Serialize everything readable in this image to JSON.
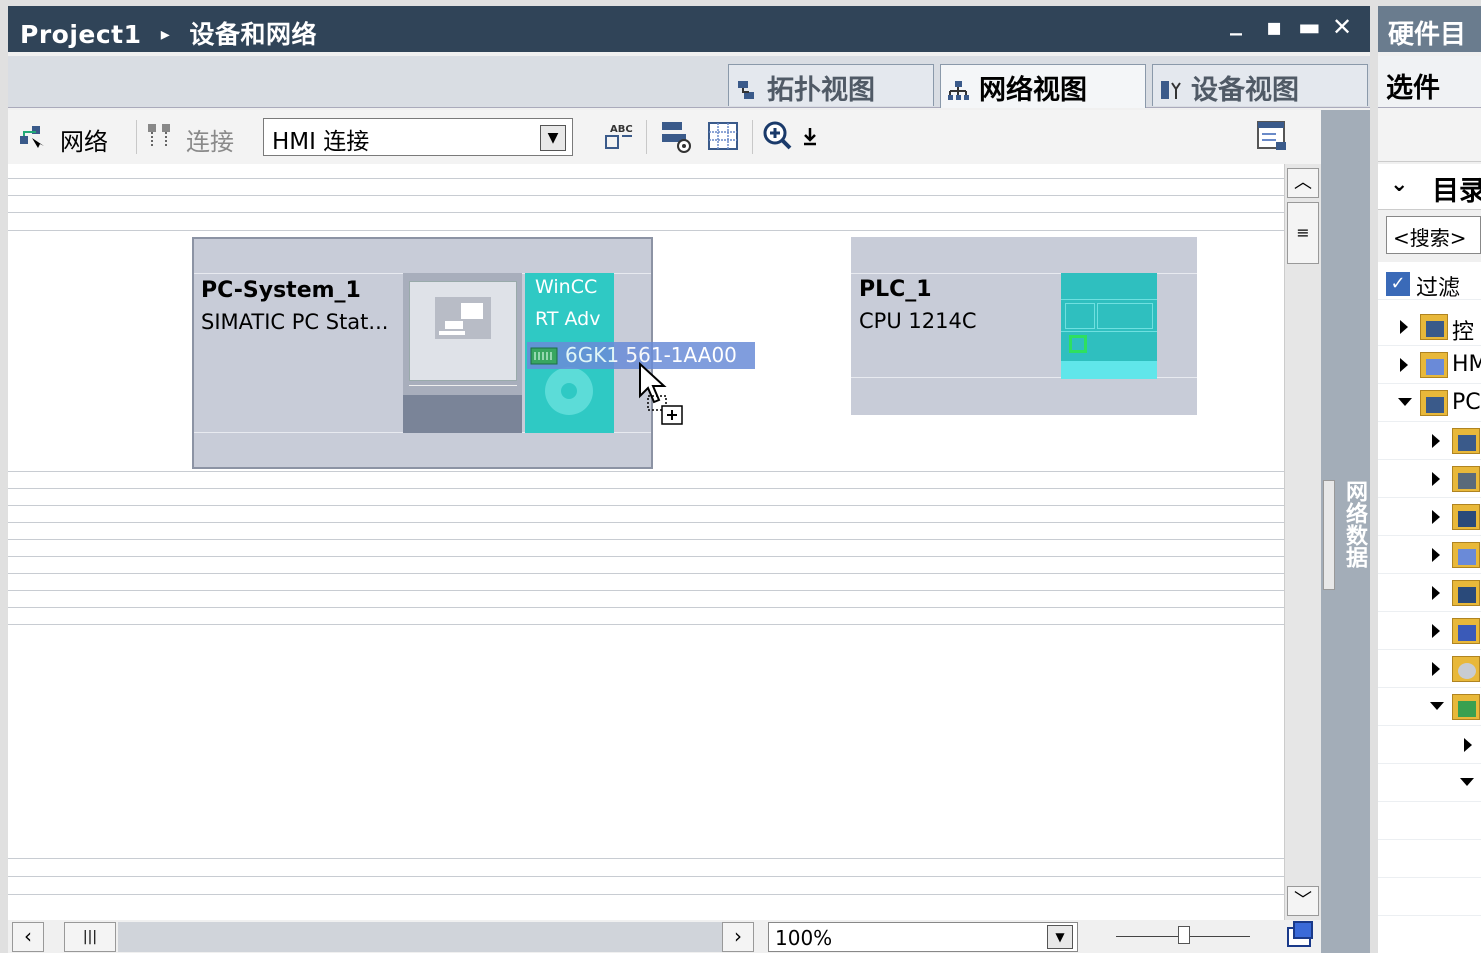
{
  "editor": {
    "breadcrumb_project": "Project1",
    "breadcrumb_sep": "▸",
    "breadcrumb_page": "设备和网络",
    "window_controls": [
      "_",
      "▪",
      "▬",
      "✕"
    ]
  },
  "tabs": [
    {
      "label": "拓扑视图",
      "active": false
    },
    {
      "label": "网络视图",
      "active": true
    },
    {
      "label": "设备视图",
      "active": false
    }
  ],
  "toolbar": {
    "network_label": "网络",
    "connect_label": "连接",
    "connection_type_value": "HMI 连接"
  },
  "devices": {
    "pc": {
      "name": "PC-System_1",
      "type": "SIMATIC PC Stat...",
      "app_line1": "WinCC",
      "app_line2": "RT Adv",
      "dragged_module": "6GK1 561-1AA00"
    },
    "plc": {
      "name": "PLC_1",
      "type": "CPU 1214C"
    }
  },
  "side_panel": {
    "network_data_label": "网络数据"
  },
  "bottom": {
    "zoom_value": "100%",
    "hscroll_grip": "|||"
  },
  "catalog": {
    "title": "硬件目",
    "options_label": "选件",
    "catalog_label": "目录",
    "search_placeholder": "<搜索>",
    "filter_label": "过滤",
    "filter_checked": true,
    "tree_items": [
      {
        "label": "控",
        "expanded": false
      },
      {
        "label": "HM",
        "expanded": false
      },
      {
        "label": "PC",
        "expanded": true
      }
    ]
  },
  "colors": {
    "titlebar": "#304458",
    "device_box": "#c8ccd8",
    "module_teal": "#2fc9c4",
    "selection_blue": "#6a8cd8"
  }
}
